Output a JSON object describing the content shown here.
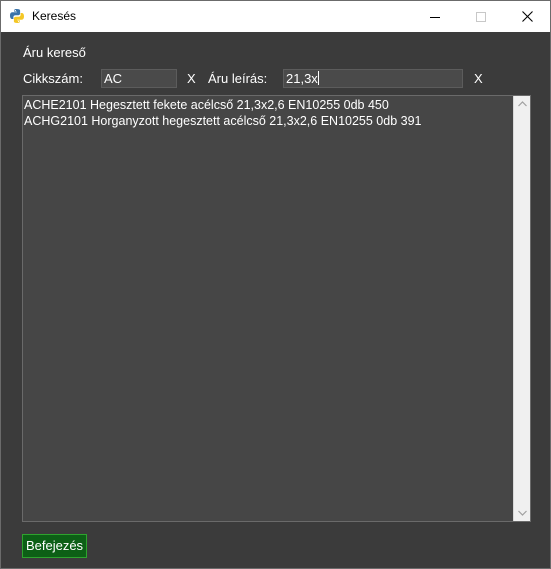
{
  "window": {
    "title": "Keresés",
    "icon": "python-icon",
    "controls": [
      "minimize-icon",
      "maximize-icon",
      "close-icon"
    ]
  },
  "search": {
    "section_title": "Áru kereső",
    "item_number_label": "Cikkszám:",
    "item_number_value": "AC",
    "item_number_clear": "X",
    "description_label": "Áru leírás:",
    "description_value": "21,3x",
    "description_clear": "X"
  },
  "results": {
    "items": [
      "ACHE2101 Hegesztett fekete acélcső 21,3x2,6 EN10255 0db 450",
      "ACHG2101 Horganyzott hegesztett acélcső 21,3x2,6 EN10255 0db 391"
    ]
  },
  "footer": {
    "finish_label": "Befejezés"
  },
  "colors": {
    "background": "#3b3b3b",
    "field_background": "#4a4a4a",
    "list_background": "#464646",
    "finish_button": "#0d5f16",
    "finish_border": "#2ea32e"
  }
}
